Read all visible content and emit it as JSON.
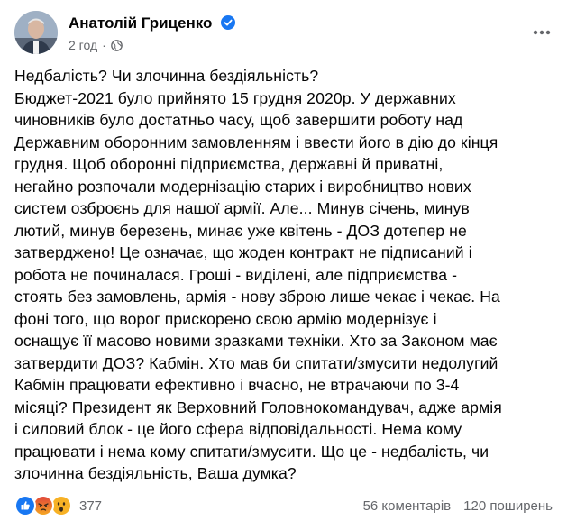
{
  "post": {
    "author": "Анатолій Гриценко",
    "time": "2 год",
    "separator": "·",
    "text": "Недбалість? Чи злочинна бездіяльність?\nБюджет-2021 було прийнято 15 грудня 2020р. У державних\nчиновників було достатньо часу, щоб завершити роботу над\nДержавним оборонним замовленням і ввести його в дію до кінця\nгрудня. Щоб оборонні підприємства, державні й приватні,\nнегайно розпочали модернізацію старих і виробництво нових\nсистем озброєнь для нашої армії. Але... Минув січень, минув\nлютий, минув березень, минає уже квітень - ДОЗ дотепер не\nзатверджено! Це означає, що жоден контракт не підписаний і\nробота не починалася. Гроші - виділені, але підприємства -\nстоять без замовлень, армія - нову зброю лише чекає і чекає. На\nфоні того, що ворог прискорено свою армію модернізує і\nоснащує її масово новими зразками техніки. Хто за Законом має\nзатвердити ДОЗ? Кабмін. Хто мав би спитати/змусити недолугий\nКабмін працювати ефективно і вчасно, не втрачаючи по 3-4\nмісяці? Президент як Верховний Головнокомандувач, адже армія\nі силовий блок - це його сфера відповідальності. Нема кому\nпрацювати і нема кому спитати/змусити. Що це - недбалість, чи\nзлочинна бездіяльність, Ваша думка?"
  },
  "footer": {
    "reactions_count": "377",
    "comments": "56 коментарів",
    "shares": "120 поширень"
  },
  "icons": {
    "verified": "verified-badge-icon",
    "audience": "globe-icon",
    "more": "more-options-icon",
    "reactions": [
      "like-reaction-icon",
      "angry-reaction-icon",
      "wow-reaction-icon"
    ]
  },
  "colors": {
    "verified": "#1877f2",
    "secondary_text": "#65676b",
    "like": "#1877f2",
    "angry": "#e9710f",
    "wow": "#f7b125"
  }
}
